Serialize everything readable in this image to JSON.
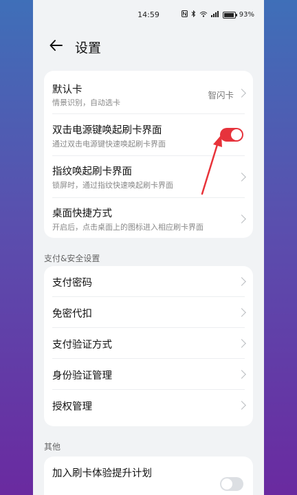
{
  "status_bar": {
    "time": "14:59",
    "battery_text": "93%",
    "battery_level": 0.93,
    "icons": [
      "nfc-icon",
      "bluetooth-icon",
      "wifi-icon",
      "signal-icon",
      "battery-icon"
    ]
  },
  "header": {
    "title": "设置"
  },
  "card1": {
    "default_card": {
      "title": "默认卡",
      "subtitle": "情景识别，自动选卡",
      "value": "智闪卡"
    },
    "double_click": {
      "title": "双击电源键唤起刷卡界面",
      "subtitle": "通过双击电源键快速唤起刷卡界面",
      "toggle_on": true
    },
    "fingerprint": {
      "title": "指纹唤起刷卡界面",
      "subtitle": "锁屏时，通过指纹快速唤起刷卡界面"
    },
    "shortcut": {
      "title": "桌面快捷方式",
      "subtitle": "开启后，点击桌面上的图标进入相应刷卡界面"
    }
  },
  "section_payment": {
    "title": "支付&安全设置",
    "items": [
      "支付密码",
      "免密代扣",
      "支付验证方式",
      "身份验证管理",
      "授权管理"
    ]
  },
  "section_other": {
    "title": "其他",
    "items": [
      "加入刷卡体验提升计划"
    ]
  },
  "colors": {
    "accent_red": "#e6333c",
    "annotation_arrow": "#e8333a"
  }
}
